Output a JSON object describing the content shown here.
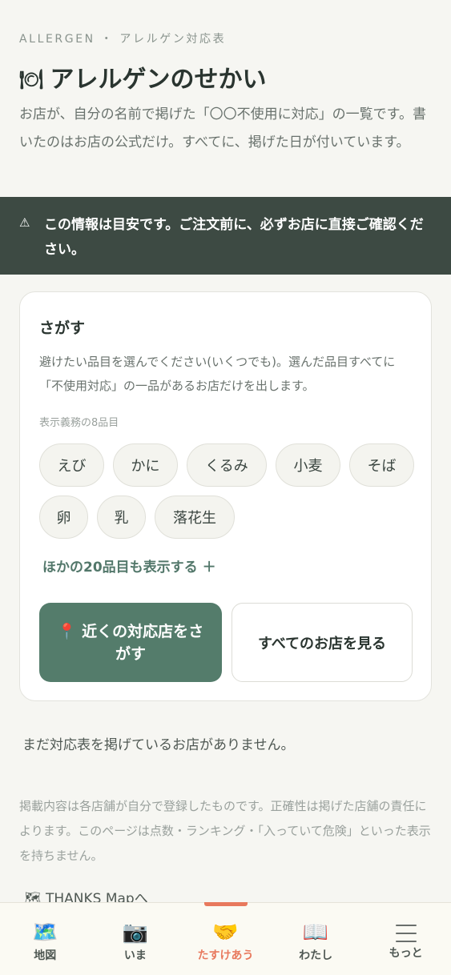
{
  "header": {
    "eyebrow": "ALLERGEN ・ アレルゲン対応表",
    "title_icon": "🍽",
    "title": "アレルゲンのせかい",
    "intro": "お店が、自分の名前で掲げた「〇〇不使用に対応」の一覧です。書いたのはお店の公式だけ。すべてに、掲げた日が付いています。"
  },
  "warning": {
    "icon": "⚠",
    "text": "この情報は目安です。ご注文前に、必ずお店に直接ご確認ください。"
  },
  "search_card": {
    "title": "さがす",
    "description": "避けたい品目を選んでください(いくつでも)。選んだ品目すべてに「不使用対応」の一品があるお店だけを出します。",
    "group_label": "表示義務の8品目",
    "chips": [
      {
        "label": "えび"
      },
      {
        "label": "かに"
      },
      {
        "label": "くるみ"
      },
      {
        "label": "小麦"
      },
      {
        "label": "そば"
      },
      {
        "label": "卵"
      },
      {
        "label": "乳"
      },
      {
        "label": "落花生"
      }
    ],
    "more_link": "ほかの20品目も表示する ＋",
    "primary_button_icon": "📍",
    "primary_button": "近くの対応店をさがす",
    "secondary_button": "すべてのお店を見る"
  },
  "empty_message": "まだ対応表を掲げているお店がありません。",
  "disclaimer": "掲載内容は各店舗が自分で登録したものです。正確性は掲げた店舗の責任によります。このページは点数・ランキング・「入っていて危険」といった表示を持ちません。",
  "thanks_link": "🗺 THANKS Mapへ",
  "bottom_nav": {
    "items": [
      {
        "icon": "🗺️",
        "label": "地図"
      },
      {
        "icon": "📷",
        "label": "いま"
      },
      {
        "icon": "🤝",
        "label": "たすけあう"
      },
      {
        "icon": "📖",
        "label": "わたし"
      },
      {
        "icon": "menu",
        "label": "もっと"
      }
    ],
    "active_index": 2,
    "active_color": "#e8795d"
  },
  "colors": {
    "primary": "#547c6b",
    "warning_bg": "#3d4a43",
    "accent": "#e8795d"
  }
}
